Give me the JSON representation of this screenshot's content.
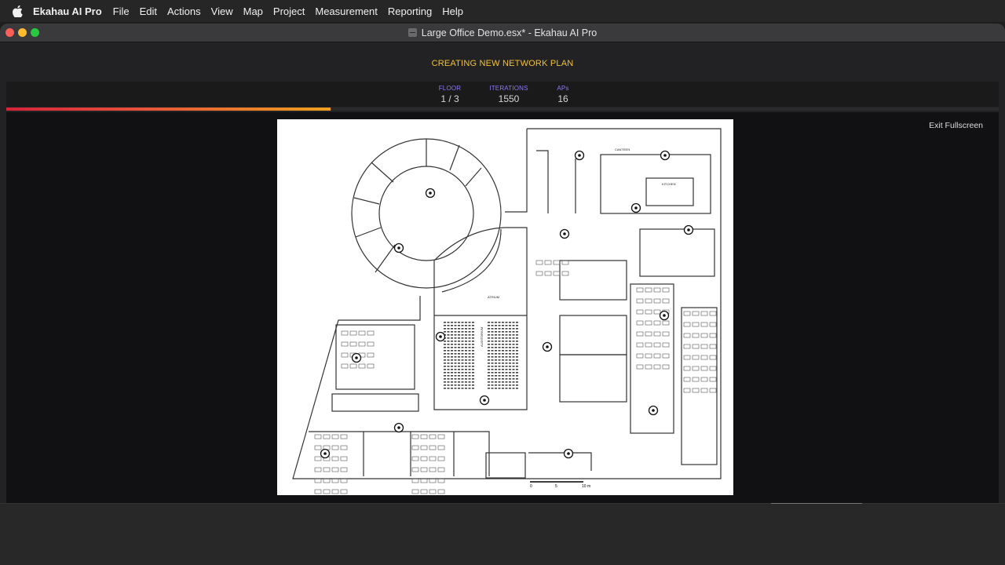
{
  "menubar": {
    "app_name": "Ekahau AI Pro",
    "items": [
      "File",
      "Edit",
      "Actions",
      "View",
      "Map",
      "Project",
      "Measurement",
      "Reporting",
      "Help"
    ]
  },
  "window": {
    "title": "Large Office Demo.esx* - Ekahau AI Pro"
  },
  "plan": {
    "heading": "CREATING NEW NETWORK PLAN",
    "progress_fraction": 0.327
  },
  "stats": {
    "floor_label": "FLOOR",
    "floor_value": "1 / 3",
    "iterations_label": "ITERATIONS",
    "iterations_value": "1550",
    "aps_label": "APs",
    "aps_value": "16"
  },
  "controls": {
    "exit_fullscreen": "Exit Fullscreen"
  },
  "floorplan": {
    "room_labels": [
      "CANTEEN",
      "KITCHEN",
      "ATRIUM",
      "AUDITORIUM"
    ],
    "scale_labels": [
      "0",
      "5",
      "10 m"
    ]
  },
  "colors": {
    "accent": "#f2c12e",
    "stat_label": "#8a78ff",
    "progress_start": "#d8233a",
    "progress_end": "#f0a21e"
  }
}
